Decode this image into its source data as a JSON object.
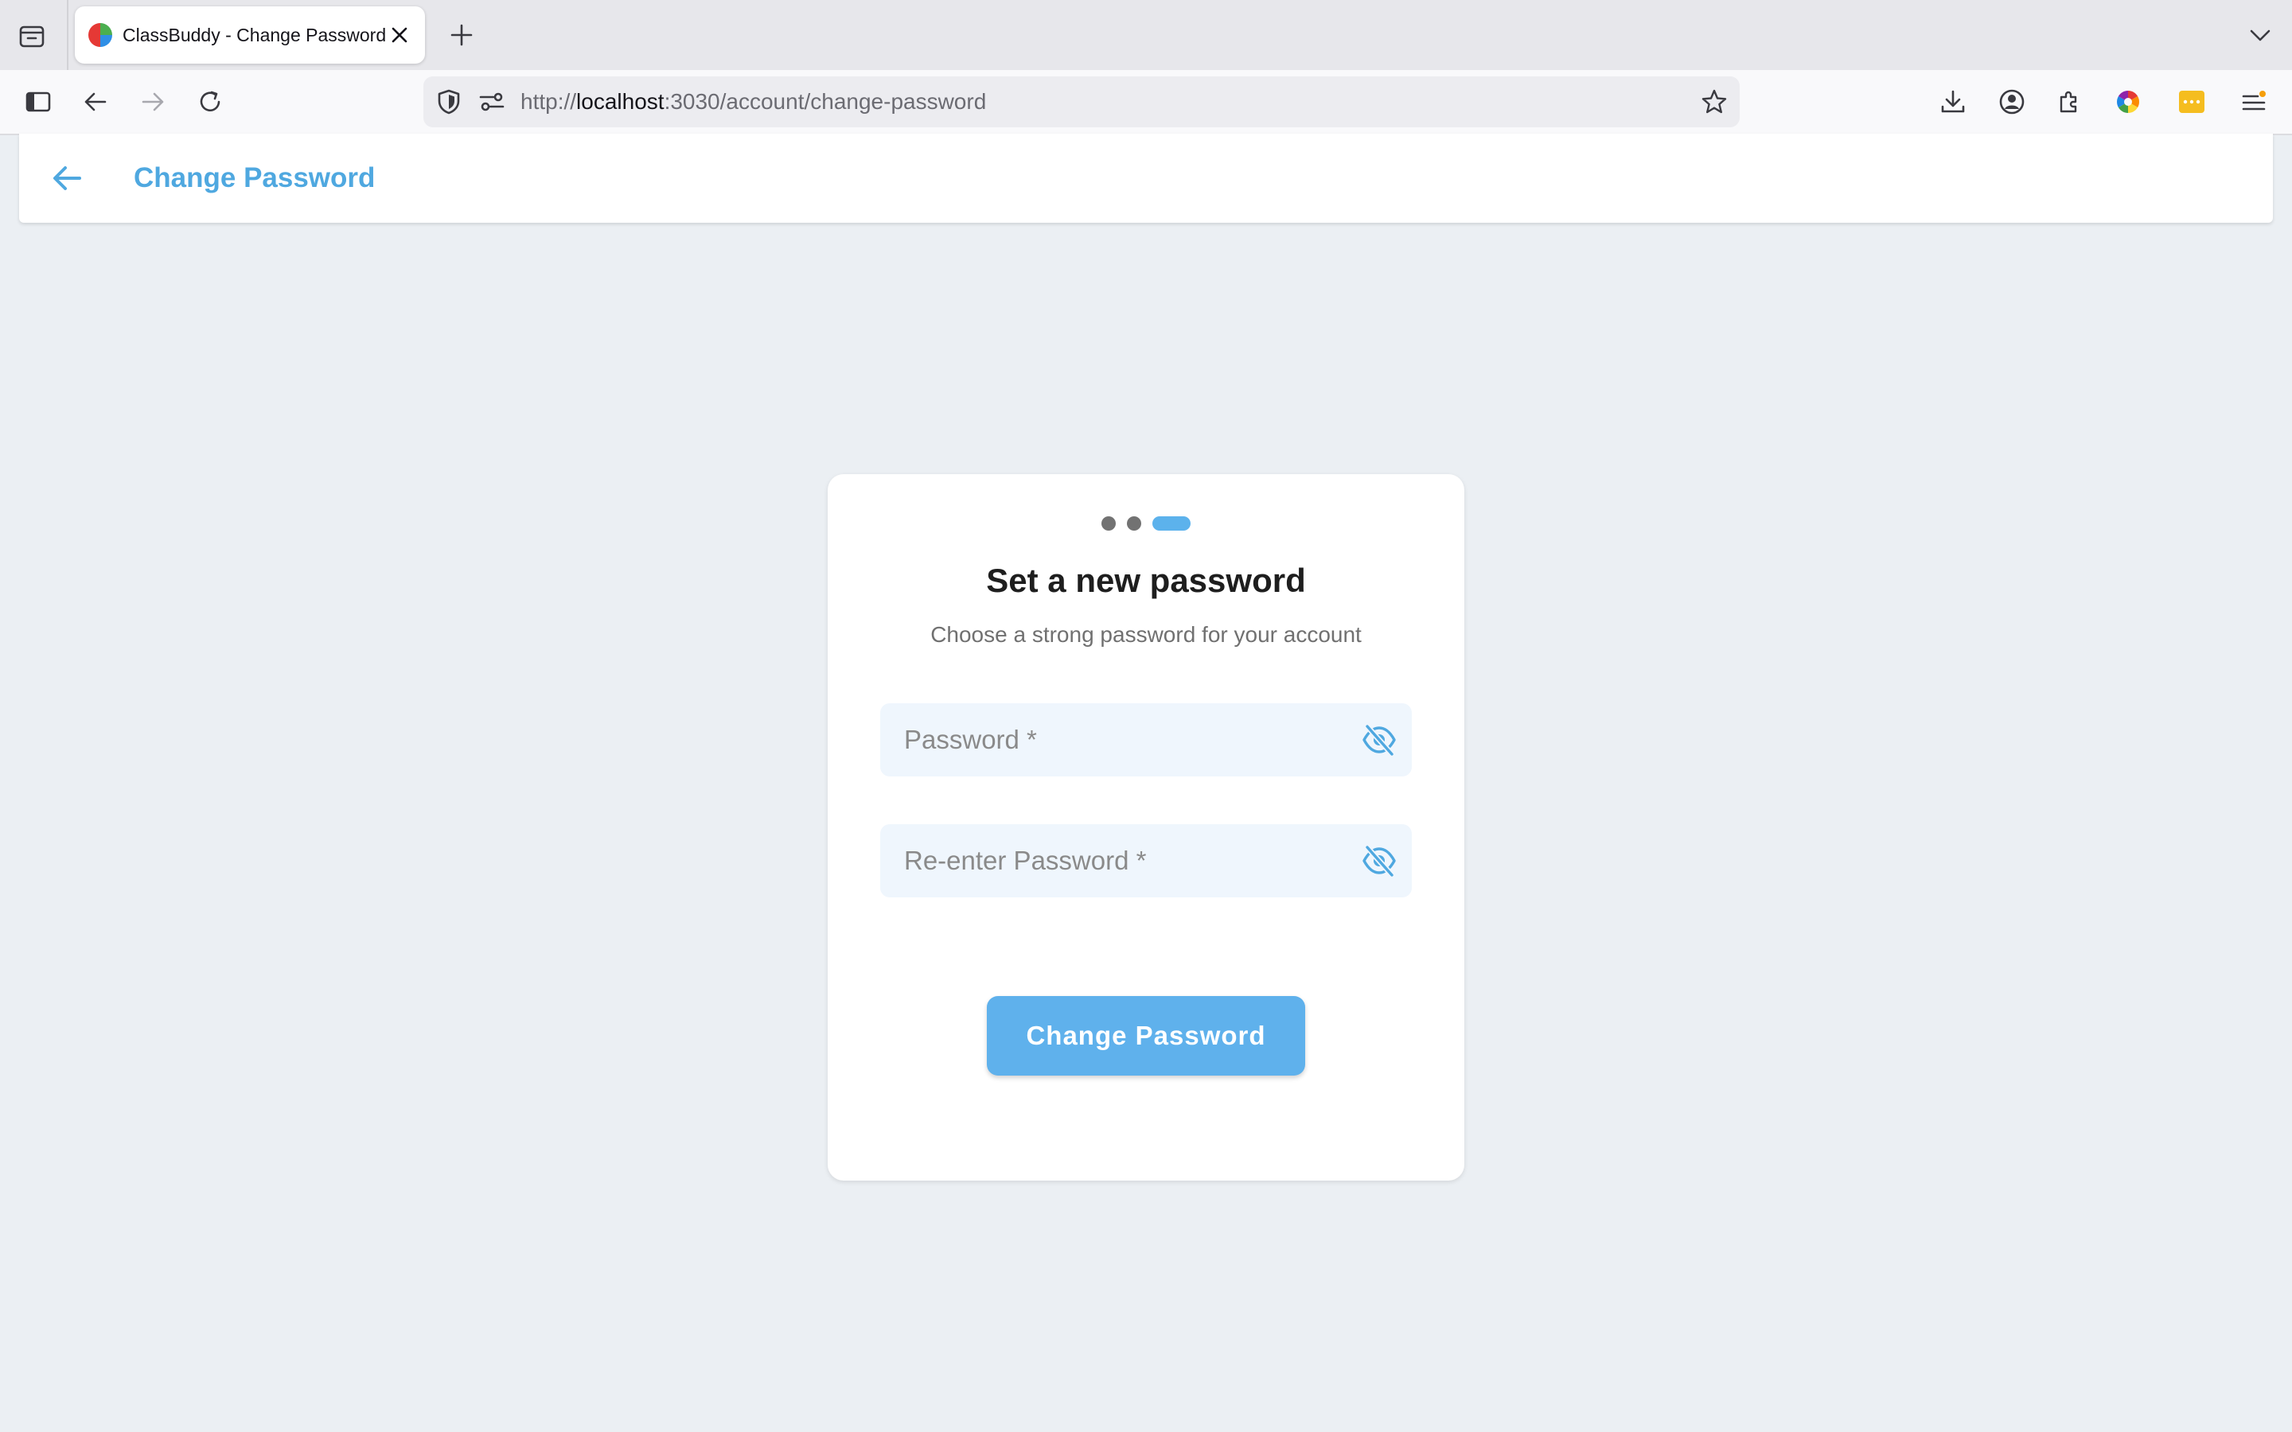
{
  "browser": {
    "tab": {
      "title": "ClassBuddy - Change Password"
    },
    "url": {
      "scheme": "http://",
      "host": "localhost",
      "rest": ":3030/account/change-password"
    },
    "icons": [
      "tab-tray-icon",
      "close-icon",
      "plus-icon",
      "chevron-down-icon",
      "sidebar-icon",
      "back-arrow-icon",
      "forward-arrow-icon",
      "reload-icon",
      "shield-icon",
      "permissions-icon",
      "star-icon",
      "download-icon",
      "account-icon",
      "extensions-icon",
      "color-wheel-icon",
      "password-manager-icon",
      "menu-icon"
    ]
  },
  "appbar": {
    "title": "Change Password"
  },
  "form": {
    "steps": {
      "total": 3,
      "current": 3
    },
    "title": "Set a new password",
    "subtitle": "Choose a strong password for your account",
    "password": {
      "placeholder": "Password *",
      "value": ""
    },
    "confirm": {
      "placeholder": "Re-enter Password *",
      "value": ""
    },
    "submit_label": "Change Password"
  },
  "colors": {
    "accent": "#4fa8e0",
    "button": "#5fb1ec",
    "page_bg": "#ebeff3",
    "field_bg": "#eff6fd"
  }
}
